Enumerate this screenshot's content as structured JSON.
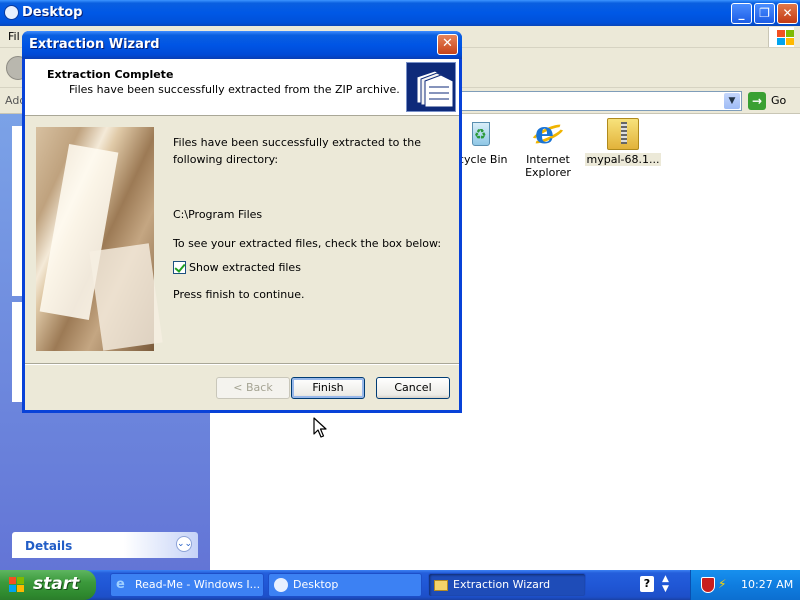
{
  "explorer": {
    "title": "Desktop",
    "menu_partial": "Fil",
    "address_label": "Add",
    "go_label": "Go",
    "details_label": "Details",
    "icons": [
      {
        "label": "cycle Bin"
      },
      {
        "label": "Internet Explorer"
      },
      {
        "label": "mypal-68.1..."
      }
    ]
  },
  "wizard": {
    "title": "Extraction Wizard",
    "close_glyph": "✕",
    "heading": "Extraction Complete",
    "subheading": "Files have been successfully extracted from the ZIP archive.",
    "message1": "Files have been successfully extracted to the following directory:",
    "directory": "C:\\Program Files",
    "message2": "To see your extracted files, check the box below:",
    "checkbox_label": "Show extracted files",
    "checkbox_checked": true,
    "message3": "Press finish to continue.",
    "buttons": {
      "back": "< Back",
      "finish": "Finish",
      "cancel": "Cancel"
    }
  },
  "taskbar": {
    "start_label": "start",
    "tasks": [
      {
        "label": "Read-Me - Windows I..."
      },
      {
        "label": "Desktop"
      },
      {
        "label": "Extraction Wizard"
      }
    ],
    "help_glyph": "?",
    "clock": "10:27 AM"
  },
  "colors": {
    "titlebar_blue": "#0058e6",
    "dialog_face": "#ece9d8",
    "start_green": "#3c9a3c",
    "tray_blue": "#0f7de0",
    "left_pane": "#6f8ede"
  }
}
